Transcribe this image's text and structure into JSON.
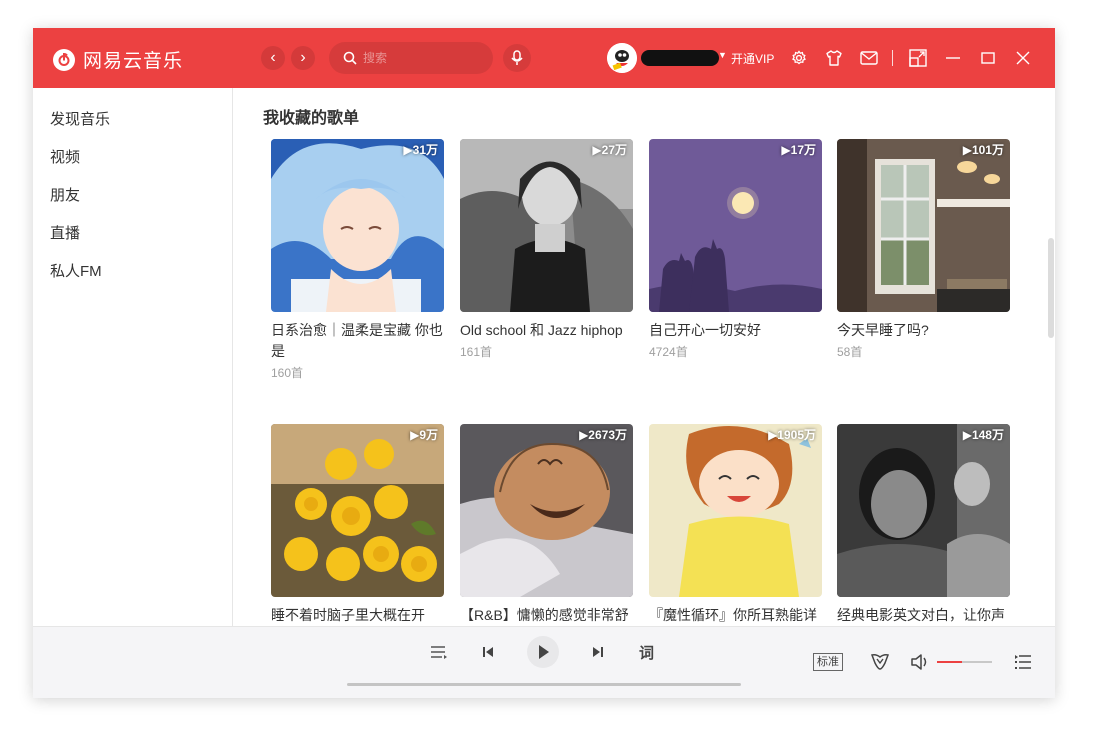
{
  "app": {
    "name": "网易云音乐"
  },
  "header": {
    "search_placeholder": "搜索",
    "vip_label": "开通VIP"
  },
  "sidebar": {
    "items": [
      {
        "label": "发现音乐"
      },
      {
        "label": "视频"
      },
      {
        "label": "朋友"
      },
      {
        "label": "直播"
      },
      {
        "label": "私人FM"
      }
    ]
  },
  "main": {
    "section_title": "我收藏的歌单",
    "playlists": [
      {
        "title": "日系治愈｜温柔是宝藏 你也是",
        "count": "160首",
        "plays": "▶31万"
      },
      {
        "title": "Old school 和 Jazz hiphop",
        "count": "161首",
        "plays": "▶27万"
      },
      {
        "title": "自己开心一切安好",
        "count": "4724首",
        "plays": "▶17万"
      },
      {
        "title": "今天早睡了吗?",
        "count": "58首",
        "plays": "▶101万"
      },
      {
        "title": "睡不着时脑子里大概在开",
        "count": "",
        "plays": "▶9万"
      },
      {
        "title": "【R&B】慵懒的感觉非常舒",
        "count": "",
        "plays": "▶2673万"
      },
      {
        "title": "『魔性循环』你所耳熟能详",
        "count": "",
        "plays": "▶1905万"
      },
      {
        "title": "经典电影英文对白，让你声",
        "count": "",
        "plays": "▶148万"
      }
    ]
  },
  "player": {
    "lyric_label": "词",
    "quality_label": "标准",
    "volume": 0.45
  },
  "colors": {
    "brand": "#ec4141"
  }
}
